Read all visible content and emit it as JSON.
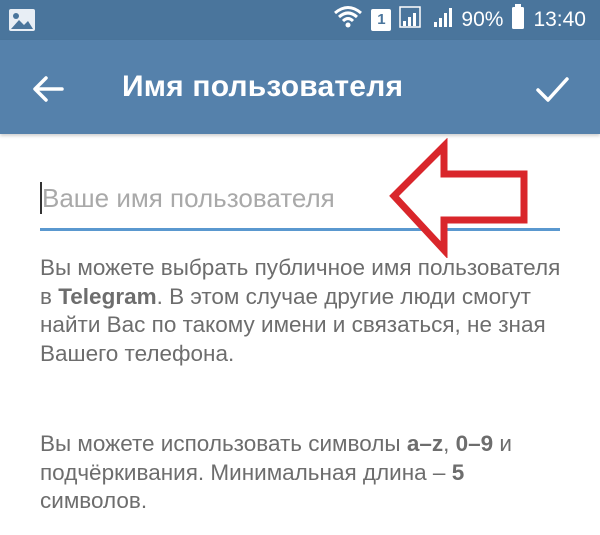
{
  "status_bar": {
    "sim_badge": "1",
    "battery": "90%",
    "time": "13:40"
  },
  "app_bar": {
    "title": "Имя пользователя"
  },
  "username_field": {
    "value": "",
    "placeholder": "Ваше имя пользователя"
  },
  "help_paragraph_1": {
    "part1": "Вы можете выбрать публичное имя пользователя в ",
    "bold1": "Telegram",
    "part2": ". В этом случае другие люди смогут найти Вас по такому имени и связаться, не зная Вашего телефона."
  },
  "help_paragraph_2": {
    "part1": "Вы можете использовать символы ",
    "bold1": "a–z",
    "part2": ", ",
    "bold2": "0–9",
    "part3": " и подчёркивания. Минимальная длина – ",
    "bold3": "5",
    "part4": " символов."
  },
  "colors": {
    "status_bar": "#4a759c",
    "app_bar": "#5581ab",
    "accent_underline": "#5a98cf",
    "annotation_arrow": "#d9262b"
  },
  "icons": {
    "gallery": "image-notification-icon",
    "wifi": "wifi-icon",
    "signal": "cell-signal-icon",
    "battery": "battery-icon",
    "back": "arrow-left-icon",
    "done": "checkmark-icon",
    "annotation": "red-arrow-left-icon"
  }
}
